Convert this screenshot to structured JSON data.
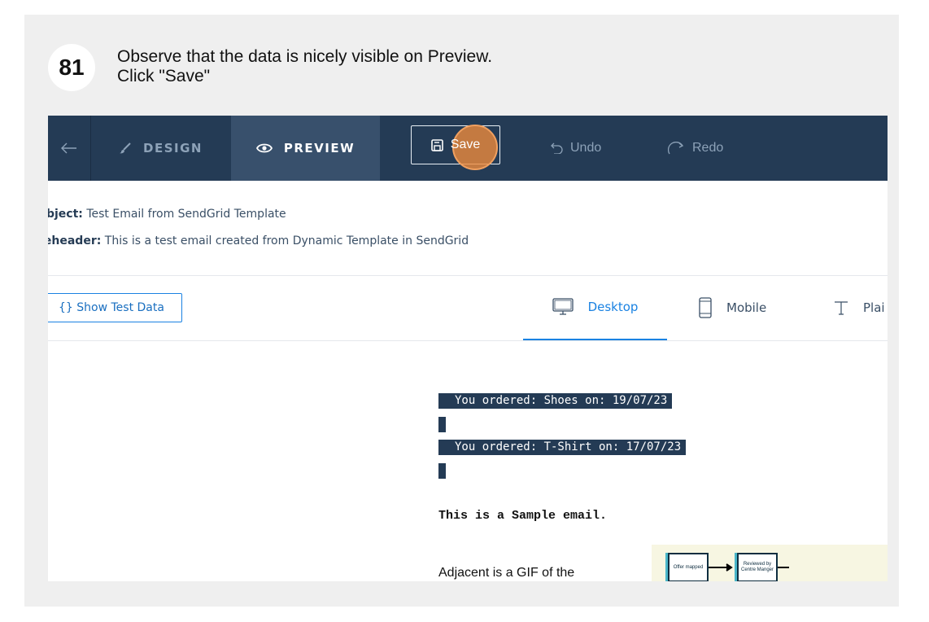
{
  "step": {
    "number": "81",
    "line1": "Observe  that the data is nicely visible on Preview.",
    "line2": "Click \"Save\""
  },
  "topbar": {
    "back_icon": "arrow-left-icon",
    "design_label": "DESIGN",
    "preview_label": "PREVIEW",
    "save_label": "Save",
    "undo_label": "Undo",
    "redo_label": "Redo"
  },
  "meta": {
    "subject_label": "ubject:",
    "subject_value": "Test Email from SendGrid Template",
    "preheader_label": "reheader:",
    "preheader_value": "This is a test email created from Dynamic Template in SendGrid"
  },
  "toolbar": {
    "test_data_label": "{} Show Test Data",
    "view_tabs": [
      {
        "label": "Desktop",
        "icon": "desktop-icon",
        "active": true
      },
      {
        "label": "Mobile",
        "icon": "mobile-icon",
        "active": false
      },
      {
        "label": "Plai",
        "icon": "text-icon",
        "active": false
      }
    ]
  },
  "preview": {
    "lines": [
      "You ordered: Shoes on: 19/07/23",
      "You ordered: T-Shirt on: 17/07/23"
    ],
    "sample_text": "This is a Sample email.",
    "adjacent_text": "Adjacent is a GIF of the",
    "gif_boxes": [
      "Offer mapped",
      "Reviewed by Centre Manger"
    ]
  },
  "colors": {
    "navbar": "#243b55",
    "accent": "#1a82e2",
    "click_marker": "#f18c3c"
  }
}
